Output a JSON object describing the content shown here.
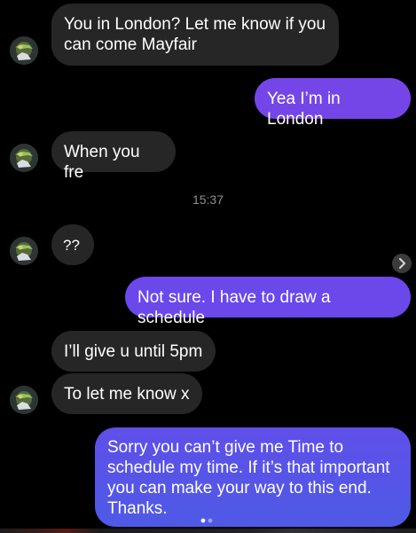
{
  "conversation": {
    "messages": [
      {
        "sender": "other",
        "lines": [
          "You in London? Let me know if you",
          "can come Mayfair"
        ]
      },
      {
        "sender": "me",
        "text": "Yea I’m in London"
      },
      {
        "sender": "other",
        "text": "When you fre"
      },
      {
        "sender": "other",
        "text": "??"
      },
      {
        "sender": "me",
        "text": "Not sure. I have to draw a schedule"
      },
      {
        "sender": "other",
        "text": "I’ll give u until 5pm"
      },
      {
        "sender": "other",
        "text": "To let me know x"
      },
      {
        "sender": "me",
        "lines": [
          "Sorry you can’t give me Time to",
          "schedule my time. If it’s that important",
          "you can make your way to this end.",
          "Thanks."
        ]
      }
    ],
    "timestamp": "15:37"
  },
  "icons": {
    "avatar": "profile-photo-icon",
    "forward": "chevron-right-icon",
    "pager": "page-dots-icon"
  },
  "colors": {
    "background": "#000000",
    "incoming_bubble": "#262626",
    "outgoing_purple": "#7446e8",
    "outgoing_blue": "#4f5ce8",
    "timestamp": "#8e8e8e"
  }
}
